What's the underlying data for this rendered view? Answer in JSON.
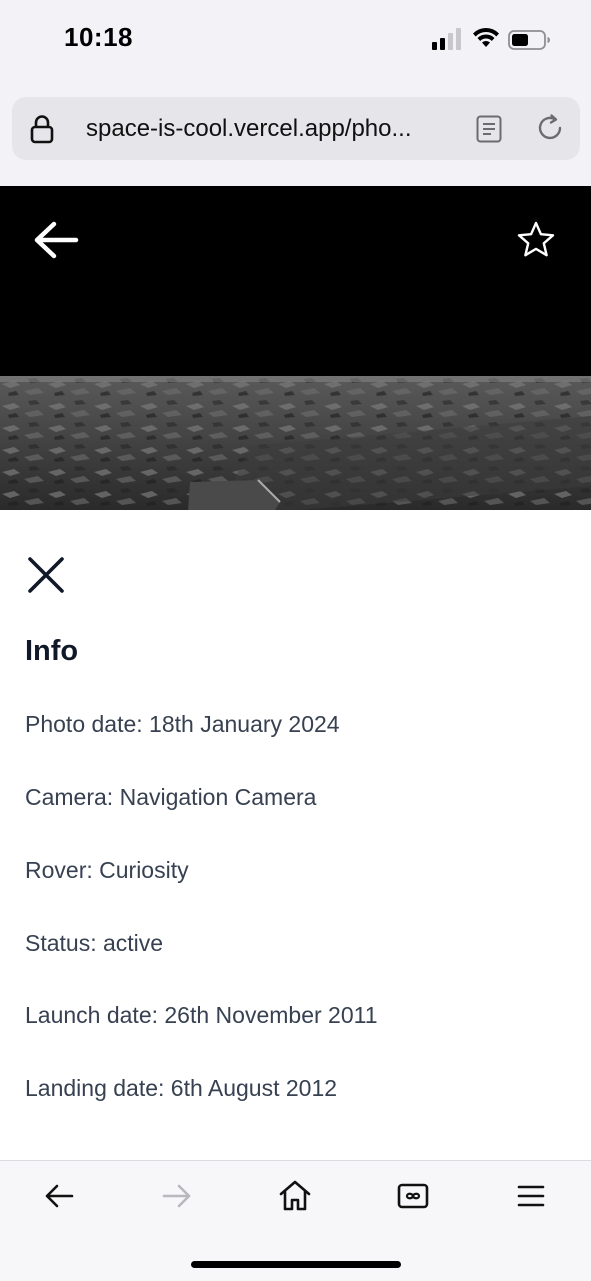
{
  "status_bar": {
    "time": "10:18"
  },
  "browser": {
    "url": "space-is-cool.vercel.app/pho..."
  },
  "info": {
    "title": "Info",
    "lines": [
      "Photo date: 18th January 2024",
      "Camera: Navigation Camera",
      "Rover: Curiosity",
      "Status: active",
      "Launch date: 26th November 2011",
      "Landing date: 6th August 2012"
    ]
  },
  "icons": {
    "back": "arrow-left-icon",
    "favorite": "star-icon",
    "close": "close-icon",
    "lock": "lock-icon",
    "reader": "reader-icon",
    "reload": "reload-icon",
    "tb_back": "chevron-left-icon",
    "tb_forward": "chevron-right-icon",
    "home": "home-icon",
    "tabs": "tabs-icon",
    "menu": "menu-icon"
  },
  "colors": {
    "chrome_bg": "#f2f2f7",
    "url_pill": "#e5e5ea",
    "hero_bg": "#000000",
    "text_primary": "#111827",
    "text_secondary": "#374151",
    "disabled": "#b8b8bd"
  }
}
